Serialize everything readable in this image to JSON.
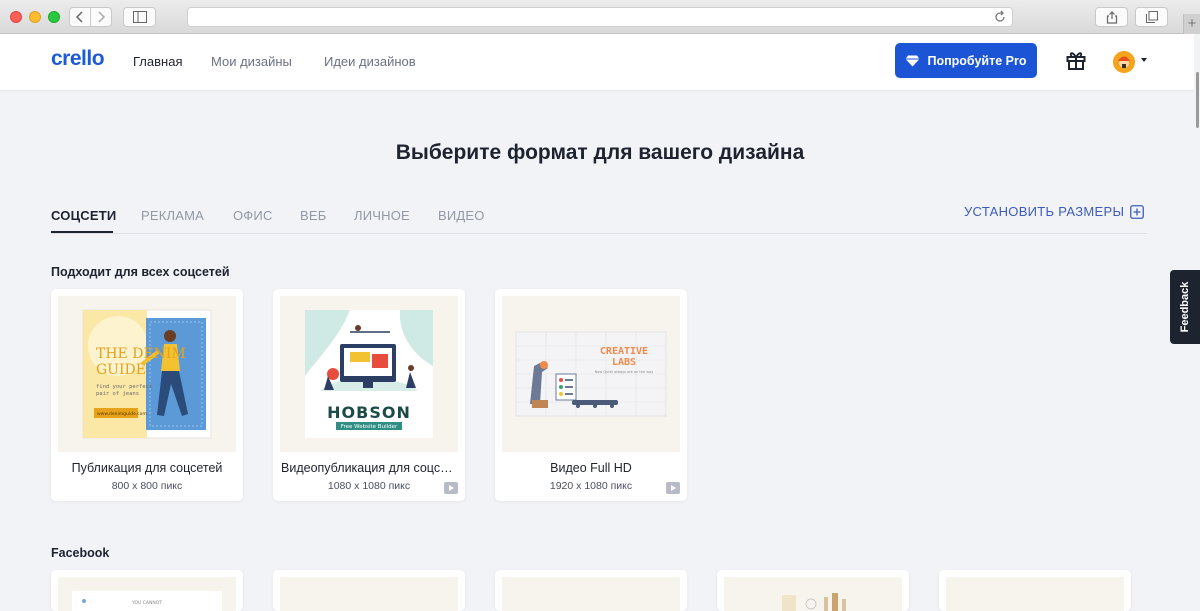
{
  "header": {
    "logo": "crello",
    "nav": [
      "Главная",
      "Мои дизайны",
      "Идеи дизайнов"
    ],
    "pro_button": "Попробуйте Pro"
  },
  "main": {
    "title": "Выберите формат для вашего дизайна",
    "tabs": [
      "СОЦСЕТИ",
      "РЕКЛАМА",
      "ОФИС",
      "ВЕБ",
      "ЛИЧНОЕ",
      "ВИДЕО"
    ],
    "custom_size": "УСТАНОВИТЬ РАЗМЕРЫ"
  },
  "sections": [
    {
      "title": "Подходит для всех соцсетей",
      "cards": [
        {
          "name": "Публикация для соцсетей",
          "size": "800 x 800 пикс",
          "video": false
        },
        {
          "name": "Видеопубликация для соцсетей",
          "size": "1080 x 1080 пикс",
          "video": true
        },
        {
          "name": "Видео Full HD",
          "size": "1920 x 1080 пикс",
          "video": true
        }
      ]
    },
    {
      "title": "Facebook"
    }
  ],
  "thumbnails": {
    "denim": {
      "title_line1": "THE DENIM",
      "title_line2": "GUIDE",
      "tagline_1": "find your perfect",
      "tagline_2": "pair of jeans",
      "footer": "www.denimguide.com"
    },
    "hobson": {
      "title": "HOBSON",
      "subtitle": "Free Website Builder"
    },
    "creative": {
      "title_line1": "CREATIVE",
      "title_line2": "LABS",
      "subtitle": "Now Quiet always are on the way"
    },
    "facebook_preview": {
      "text": "YOU CANNOT"
    }
  },
  "feedback_label": "Feedback",
  "colors": {
    "brand": "#1c5bd6",
    "pro_button": "#1c54d6",
    "text_dark": "#1e2330",
    "page_bg": "#f2f3f6"
  }
}
